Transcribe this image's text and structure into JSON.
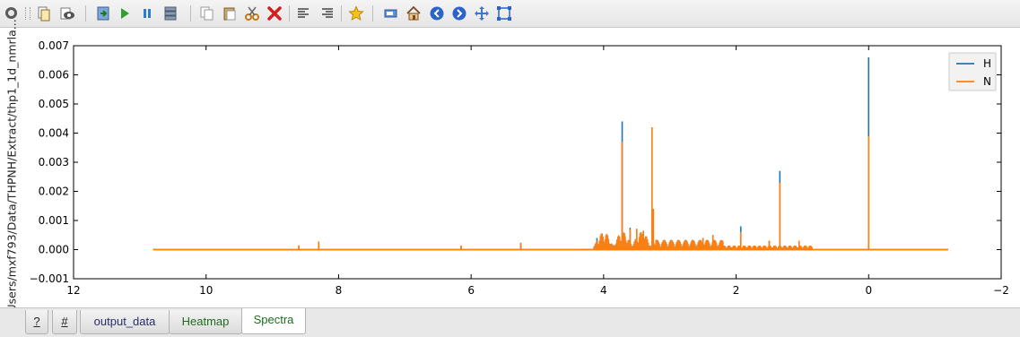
{
  "window": {
    "path_label": "/Users/mxf793/Data/THPNH/Extract/thp1_1d_nmrla..."
  },
  "toolbar": {
    "icons": [
      "copy-icon",
      "preview-icon",
      "export-icon",
      "run-icon",
      "pause-icon",
      "stack-icon",
      "duplicate-icon",
      "paste-icon",
      "cut-icon",
      "delete-icon",
      "align-left-icon",
      "align-right-icon",
      "favorite-star-icon",
      "tag-icon",
      "home-icon",
      "back-icon",
      "forward-icon",
      "pan-icon",
      "zoom-rect-icon"
    ]
  },
  "tabs": [
    {
      "label": "?"
    },
    {
      "label": "#"
    },
    {
      "label": "output_data"
    },
    {
      "label": "Heatmap"
    },
    {
      "label": "Spectra"
    }
  ],
  "active_tab": "Spectra",
  "chart_data": {
    "type": "line",
    "title": "",
    "xlabel": "",
    "ylabel": "",
    "xlim": [
      12,
      -2
    ],
    "ylim": [
      -0.001,
      0.007
    ],
    "xticks": [
      "12",
      "10",
      "8",
      "6",
      "4",
      "2",
      "0",
      "−2"
    ],
    "yticks": [
      "0.007",
      "0.006",
      "0.005",
      "0.004",
      "0.003",
      "0.002",
      "0.001",
      "0.000",
      "−0.001"
    ],
    "legend_position": "top-right",
    "colors": {
      "H": "#1f77b4",
      "N": "#ff7f0e"
    },
    "series": [
      {
        "name": "H",
        "x": [
          10.8,
          8.6,
          8.3,
          6.15,
          5.25,
          4.1,
          3.72,
          3.6,
          3.5,
          3.4,
          3.27,
          3.25,
          2.5,
          2.35,
          1.93,
          1.5,
          1.34,
          1.05,
          0.0,
          -1.2
        ],
        "values": [
          0.0,
          0.00012,
          0.00025,
          0.00012,
          0.00022,
          0.0004,
          0.0044,
          0.00075,
          0.0007,
          0.0006,
          0.0042,
          0.0014,
          0.0004,
          0.0005,
          0.0008,
          0.0003,
          0.0027,
          0.0003,
          0.0066,
          0.0
        ]
      },
      {
        "name": "N",
        "x": [
          10.8,
          8.6,
          8.3,
          6.15,
          5.25,
          4.1,
          3.72,
          3.6,
          3.5,
          3.4,
          3.27,
          3.25,
          2.5,
          2.35,
          1.93,
          1.5,
          1.34,
          1.05,
          0.0,
          -1.2
        ],
        "values": [
          0.0,
          0.00015,
          0.00028,
          0.00014,
          0.00024,
          0.0003,
          0.0037,
          0.0007,
          0.00072,
          0.00065,
          0.0042,
          0.0014,
          0.0004,
          0.00048,
          0.0006,
          0.0003,
          0.0023,
          0.0003,
          0.0039,
          0.0
        ]
      }
    ]
  }
}
